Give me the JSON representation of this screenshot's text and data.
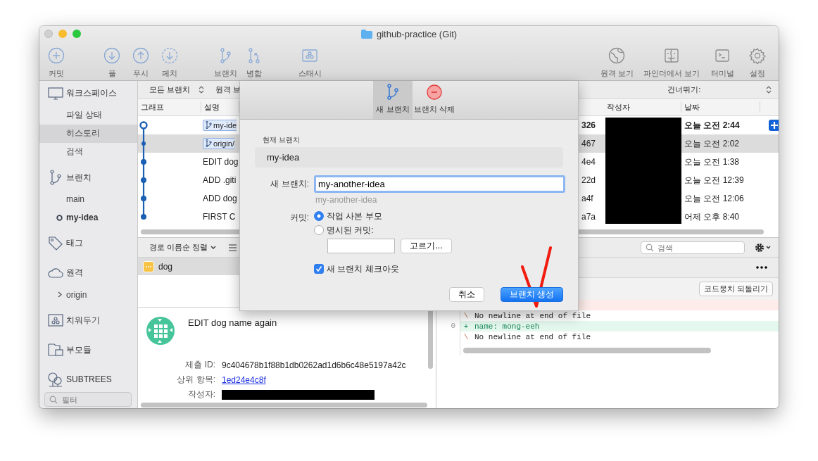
{
  "window": {
    "title": "github-practice (Git)"
  },
  "toolbar": {
    "groups": [
      [
        {
          "label": "커밋"
        }
      ],
      [
        {
          "label": "풀"
        },
        {
          "label": "푸시"
        },
        {
          "label": "페치"
        }
      ],
      [
        {
          "label": "브랜치"
        },
        {
          "label": "병합"
        }
      ],
      [
        {
          "label": "스태시"
        }
      ]
    ],
    "right": [
      {
        "label": "원격 보기"
      },
      {
        "label": "파인더에서 보기"
      },
      {
        "label": "터미널"
      },
      {
        "label": "설정"
      }
    ]
  },
  "sidebar": {
    "sections": [
      {
        "label": "워크스페이스",
        "children": [
          {
            "label": "파일 상태",
            "selected": false
          },
          {
            "label": "히스토리",
            "selected": true
          },
          {
            "label": "검색",
            "selected": false
          }
        ]
      },
      {
        "label": "브랜치",
        "children": [
          {
            "label": "main",
            "selected": false,
            "current": false
          },
          {
            "label": "my-idea",
            "selected": false,
            "current": true
          }
        ]
      },
      {
        "label": "태그"
      },
      {
        "label": "원격",
        "children": [
          {
            "label": "origin",
            "selected": false,
            "expanded": false
          }
        ]
      },
      {
        "label": "치워두기"
      },
      {
        "label": "부모듈"
      },
      {
        "label": "SUBTREES"
      }
    ],
    "filter": {
      "placeholder": "필터"
    }
  },
  "history": {
    "branch_filter": "모든 브랜치",
    "remote_filter": "원격 브",
    "skip_label": "건너뛰기:",
    "columns": [
      "그래프",
      "설명",
      "작성자",
      "날짜"
    ],
    "rows": [
      {
        "tag": "my-ide",
        "commit": "326",
        "date": "오늘 오전 2:44",
        "head": true,
        "selected": false
      },
      {
        "tag": "origin/",
        "commit": "467",
        "date": "오늘 오전 2:02",
        "head": false,
        "selected": true
      },
      {
        "description": "EDIT dog",
        "commit": "4e4",
        "date": "오늘 오전 1:38",
        "head": false,
        "selected": false
      },
      {
        "description": "ADD .giti",
        "commit": "22d",
        "date": "오늘 오전 12:39",
        "head": false,
        "selected": false
      },
      {
        "description": "ADD dog",
        "commit": "a4f",
        "date": "오늘 오전 12:06",
        "head": false,
        "selected": false
      },
      {
        "description": "FIRST C",
        "commit": "a7a",
        "date": "어제 오후 8:40",
        "head": false,
        "selected": false
      }
    ]
  },
  "files": {
    "sort_label": "경로 이름순 정렬",
    "items": [
      {
        "name": "dog",
        "selected": true
      }
    ]
  },
  "commit": {
    "message": "EDIT dog name again",
    "fields": [
      {
        "label": "제출 ID:",
        "kind": "text",
        "value": "9c404678b1f88b1db0262ad1d6b6c48e5197a42c"
      },
      {
        "label": "상위 항목:",
        "kind": "link",
        "value": "1ed24e4c8f"
      },
      {
        "label": "작성자:",
        "kind": "redacted"
      }
    ]
  },
  "diff": {
    "search_placeholder": "검색",
    "revert_button": "코드뭉치 되돌리기",
    "lines": [
      {
        "kind": "removed"
      },
      {
        "kind": "note",
        "marker": "\\",
        "text": "No newline at end of file"
      },
      {
        "kind": "added",
        "number": "0",
        "marker": "+",
        "text": "name: mong-eeh"
      },
      {
        "kind": "note",
        "marker": "\\",
        "text": "No newline at end of file"
      }
    ]
  },
  "dialog": {
    "tabs": [
      {
        "label": "새 브랜치",
        "selected": true
      },
      {
        "label": "브랜치 삭제",
        "selected": false
      }
    ],
    "current_branch_label": "현재 브랜치",
    "current_branch": "my-idea",
    "new_branch_label": "새 브랜치:",
    "new_branch_value": "my-another-idea",
    "new_branch_hint": "my-another-idea",
    "commit_label": "커밋:",
    "commit_options": [
      {
        "label": "작업 사본 부모",
        "selected": true
      },
      {
        "label": "명시된 커밋:",
        "selected": false
      }
    ],
    "pick_button": "고르기...",
    "checkout": {
      "label": "새 브랜치 체크아웃",
      "checked": true
    },
    "buttons": [
      {
        "label": "취소",
        "kind": "cancel"
      },
      {
        "label": "브랜치 생성",
        "kind": "primary"
      }
    ]
  }
}
